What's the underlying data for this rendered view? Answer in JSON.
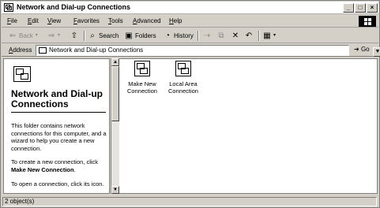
{
  "window": {
    "title": "Network and Dial-up Connections",
    "min_glyph": "_",
    "max_glyph": "□",
    "close_glyph": "×"
  },
  "menu": {
    "items": [
      {
        "label": "File"
      },
      {
        "label": "Edit"
      },
      {
        "label": "View"
      },
      {
        "label": "Favorites"
      },
      {
        "label": "Tools"
      },
      {
        "label": "Advanced"
      },
      {
        "label": "Help"
      }
    ]
  },
  "toolbar": {
    "back_label": "Back",
    "search_label": "Search",
    "folders_label": "Folders",
    "history_label": "History",
    "back_glyph": "⇐",
    "forward_glyph": "⇒",
    "up_glyph": "⇧",
    "search_glyph": "⌕",
    "folders_glyph": "▣",
    "history_glyph": "◔",
    "move_glyph": "⇢",
    "copy_glyph": "⧉",
    "delete_glyph": "✕",
    "undo_glyph": "↶",
    "views_glyph": "▦"
  },
  "address": {
    "label": "Address",
    "value": "Network and Dial-up Connections",
    "go_label": "Go",
    "dropdown_glyph": "▼"
  },
  "leftpane": {
    "title": "Network and Dial-up Connections",
    "paragraph1": "This folder contains network connections for this computer, and a wizard to help you create a new connection.",
    "paragraph2_prefix": "To create a new connection, click",
    "paragraph2_bold": "Make New Connection",
    "paragraph2_suffix": ".",
    "paragraph3": "To open a connection, click its icon."
  },
  "scrollbar": {
    "up_glyph": "▲",
    "down_glyph": "▼"
  },
  "main": {
    "items": [
      {
        "label": "Make New Connection",
        "icon": "wizard-connection-icon"
      },
      {
        "label": "Local Area Connection",
        "icon": "lan-connection-icon"
      }
    ]
  },
  "status": {
    "text": "2 object(s)"
  }
}
